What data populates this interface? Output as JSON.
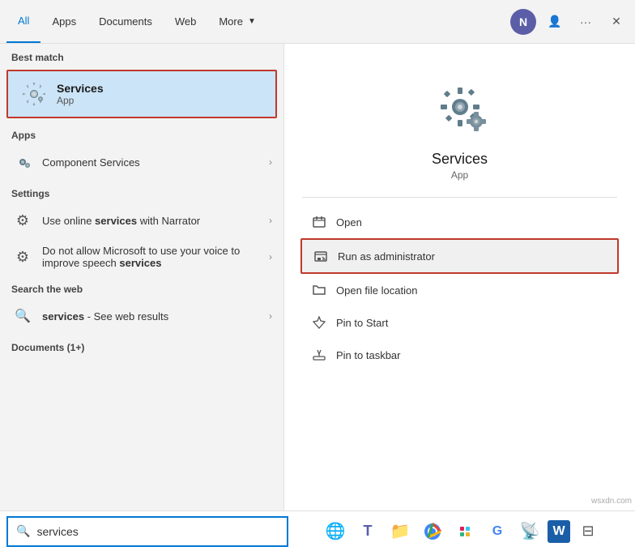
{
  "nav": {
    "tabs": [
      {
        "label": "All",
        "active": true
      },
      {
        "label": "Apps",
        "active": false
      },
      {
        "label": "Documents",
        "active": false
      },
      {
        "label": "Web",
        "active": false
      },
      {
        "label": "More",
        "active": false,
        "hasArrow": true
      }
    ],
    "avatar_letter": "N",
    "more_btn_label": "···",
    "close_btn": "✕"
  },
  "left_panel": {
    "best_match_label": "Best match",
    "best_match_item": {
      "title": "Services",
      "subtitle": "App"
    },
    "apps_section_label": "Apps",
    "apps_items": [
      {
        "label": "Component Services",
        "bold": false
      }
    ],
    "settings_section_label": "Settings",
    "settings_items": [
      {
        "label_pre": "Use online ",
        "label_bold": "services",
        "label_post": " with Narrator"
      },
      {
        "label_pre": "Do not allow Microsoft to use your voice to improve speech ",
        "label_bold": "services",
        "label_post": ""
      }
    ],
    "web_section_label": "Search the web",
    "web_item": {
      "label_bold": "services",
      "label_post": " - See web results"
    },
    "docs_section_label": "Documents (1+)"
  },
  "right_panel": {
    "app_name": "Services",
    "app_type": "App",
    "actions": [
      {
        "label": "Open",
        "icon": "open"
      },
      {
        "label": "Run as administrator",
        "icon": "runas",
        "highlighted": true
      },
      {
        "label": "Open file location",
        "icon": "folder"
      },
      {
        "label": "Pin to Start",
        "icon": "pin"
      },
      {
        "label": "Pin to taskbar",
        "icon": "pintaskbar"
      }
    ]
  },
  "bottom": {
    "search_placeholder": "services",
    "search_value": "services"
  },
  "taskbar_icons": [
    {
      "name": "edge",
      "symbol": "🌐"
    },
    {
      "name": "teams",
      "symbol": "👥"
    },
    {
      "name": "explorer",
      "symbol": "📁"
    },
    {
      "name": "chrome",
      "symbol": "⬤"
    },
    {
      "name": "slack",
      "symbol": "⊞"
    },
    {
      "name": "google",
      "symbol": "G"
    },
    {
      "name": "satellite",
      "symbol": "📡"
    },
    {
      "name": "word",
      "symbol": "W"
    },
    {
      "name": "extra",
      "symbol": "⊟"
    }
  ],
  "watermark": "wsxdn.com"
}
